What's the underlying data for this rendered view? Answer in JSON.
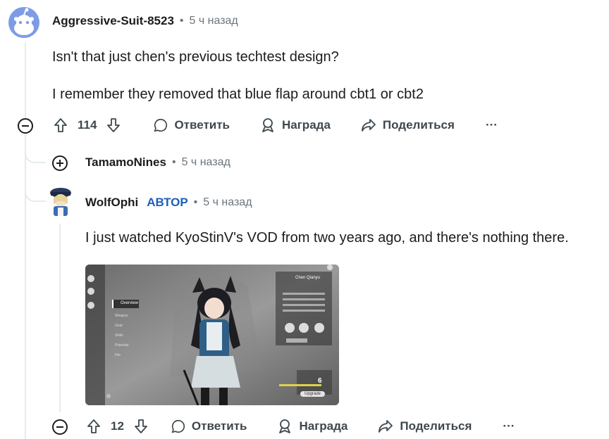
{
  "comment1": {
    "username": "Aggressive-Suit-8523",
    "time": "5 ч назад",
    "lines": [
      "Isn't that just chen's previous techtest design?",
      "I remember they removed that blue flap around cbt1 or cbt2"
    ],
    "votes": "114"
  },
  "comment2": {
    "username": "TamamoNines",
    "time": "5 ч назад"
  },
  "comment3": {
    "username": "WolfOphi",
    "author_badge": "АВТОР",
    "time": "5 ч назад",
    "text": "I just watched KyoStinV's VOD from two years ago, and there's nothing there.",
    "votes": "12"
  },
  "actions": {
    "reply": "Ответить",
    "award": "Награда",
    "share": "Поделиться",
    "more": "···",
    "separator": "•"
  },
  "game_ui": {
    "tab_overview": "Overview",
    "menu": [
      "Weapon",
      "Gear",
      "Skills",
      "Potential",
      "File"
    ],
    "char_name": "Chen Qianyu",
    "upgrade": "Upgrade",
    "level": "6"
  },
  "colors": {
    "accent": "#1d5fb8",
    "thread": "#e5ebee",
    "meta": "#6a757d"
  }
}
